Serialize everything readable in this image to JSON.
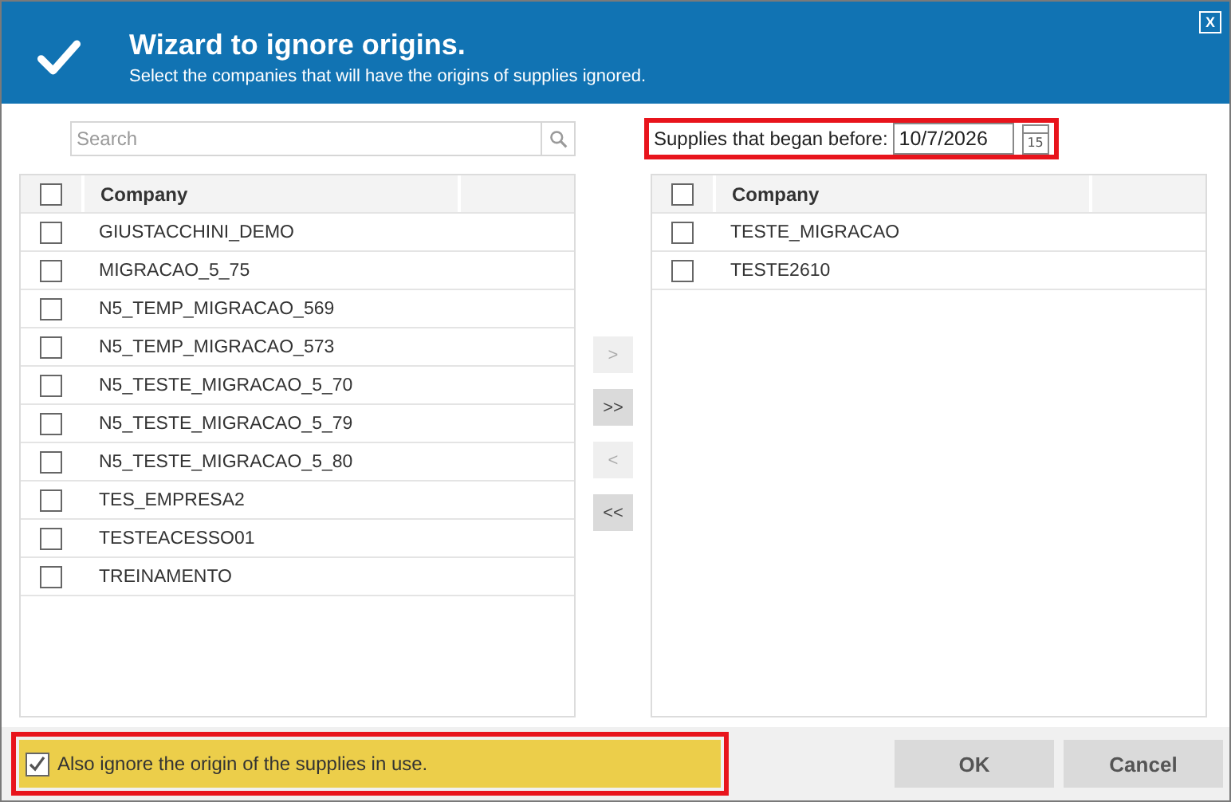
{
  "header": {
    "title": "Wizard to ignore origins.",
    "subtitle": "Select the companies that will have the origins of supplies ignored.",
    "close_label": "X"
  },
  "search": {
    "placeholder": "Search"
  },
  "date_filter": {
    "label": "Supplies that began before:",
    "value": "10/7/2026",
    "calendar_day": "15",
    "highlighted": true
  },
  "left_table": {
    "all_checked": false,
    "columns": [
      "Company"
    ],
    "rows": [
      {
        "company": "GIUSTACCHINI_DEMO",
        "checked": false
      },
      {
        "company": "MIGRACAO_5_75",
        "checked": false
      },
      {
        "company": "N5_TEMP_MIGRACAO_569",
        "checked": false
      },
      {
        "company": "N5_TEMP_MIGRACAO_573",
        "checked": false
      },
      {
        "company": "N5_TESTE_MIGRACAO_5_70",
        "checked": false
      },
      {
        "company": "N5_TESTE_MIGRACAO_5_79",
        "checked": false
      },
      {
        "company": "N5_TESTE_MIGRACAO_5_80",
        "checked": false
      },
      {
        "company": "TES_EMPRESA2",
        "checked": false
      },
      {
        "company": "TESTEACESSO01",
        "checked": false
      },
      {
        "company": "TREINAMENTO",
        "checked": false
      }
    ]
  },
  "move_buttons": [
    {
      "label": ">",
      "disabled": true
    },
    {
      "label": ">>",
      "disabled": false
    },
    {
      "label": "<",
      "disabled": true
    },
    {
      "label": "<<",
      "disabled": false
    }
  ],
  "right_table": {
    "all_checked": false,
    "columns": [
      "Company"
    ],
    "rows": [
      {
        "company": "TESTE_MIGRACAO",
        "checked": false
      },
      {
        "company": "TESTE2610",
        "checked": false
      }
    ]
  },
  "option": {
    "label": "Also ignore the origin of the supplies in use.",
    "checked": true,
    "highlighted": true
  },
  "buttons": [
    {
      "label": "OK"
    },
    {
      "label": "Cancel"
    }
  ]
}
